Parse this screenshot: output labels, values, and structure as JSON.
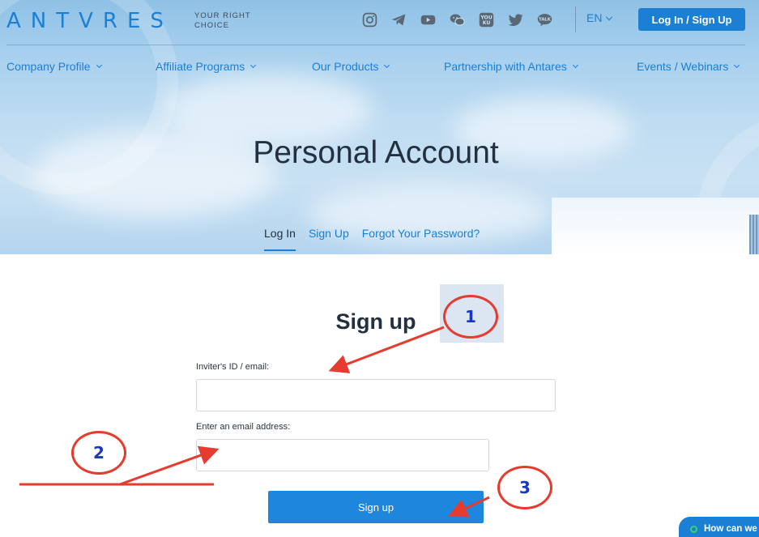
{
  "header": {
    "logo_text": "ANTVRES",
    "tagline": "YOUR RIGHT CHOICE",
    "social_icons": [
      "instagram-icon",
      "telegram-icon",
      "youtube-icon",
      "wechat-icon",
      "youku-icon",
      "twitter-icon",
      "kakaotalk-icon"
    ],
    "youku_text": "YOU KU",
    "talk_text": "TALK",
    "language": "EN",
    "login_button": "Log In / Sign Up"
  },
  "nav": {
    "items": [
      {
        "label": "Company Profile"
      },
      {
        "label": "Affiliate Programs"
      },
      {
        "label": "Our Products"
      },
      {
        "label": "Partnership with Antares"
      },
      {
        "label": "Events / Webinars"
      }
    ]
  },
  "page": {
    "title": "Personal Account",
    "tabs": [
      {
        "label": "Log In",
        "active": true
      },
      {
        "label": "Sign Up",
        "active": false
      },
      {
        "label": "Forgot Your Password?",
        "active": false
      }
    ]
  },
  "form": {
    "title": "Sign up",
    "inviter_label": "Inviter's ID / email:",
    "inviter_value": "",
    "email_label": "Enter an email address:",
    "email_value": "",
    "submit_label": "Sign up"
  },
  "annotations": {
    "step1": "1",
    "step2": "2",
    "step3": "3",
    "color": "#e63b2e",
    "number_color": "#1638c4"
  },
  "chat": {
    "label": "How can we"
  },
  "colors": {
    "brand": "#1b7fd4",
    "title_text": "#22303f"
  }
}
